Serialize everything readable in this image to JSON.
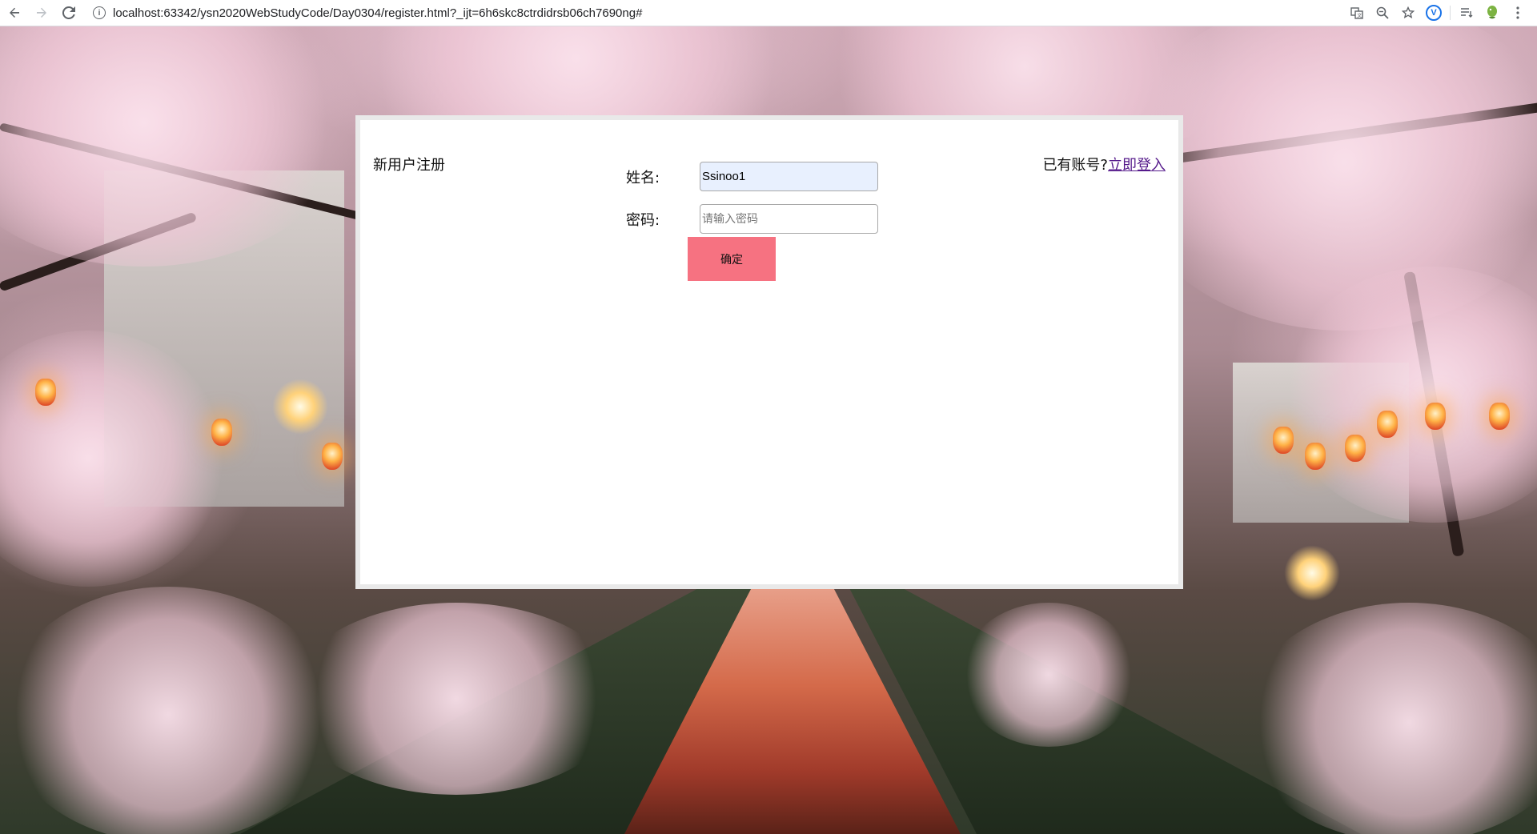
{
  "browser": {
    "url": "localhost:63342/ysn2020WebStudyCode/Day0304/register.html?_ijt=6h6skc8ctrdidrsb06ch7690ng#",
    "extension_label": "V"
  },
  "page": {
    "title": "新用户注册",
    "login_prompt": "已有账号?",
    "login_link": "立即登入"
  },
  "form": {
    "name_label": "姓名:",
    "name_value": "Ssinoo1",
    "password_label": "密码:",
    "password_placeholder": "请输入密码",
    "submit_label": "确定"
  },
  "colors": {
    "submit_bg": "#f67281",
    "autofill_bg": "#e8f0fe",
    "visited_link": "#551a8b"
  }
}
